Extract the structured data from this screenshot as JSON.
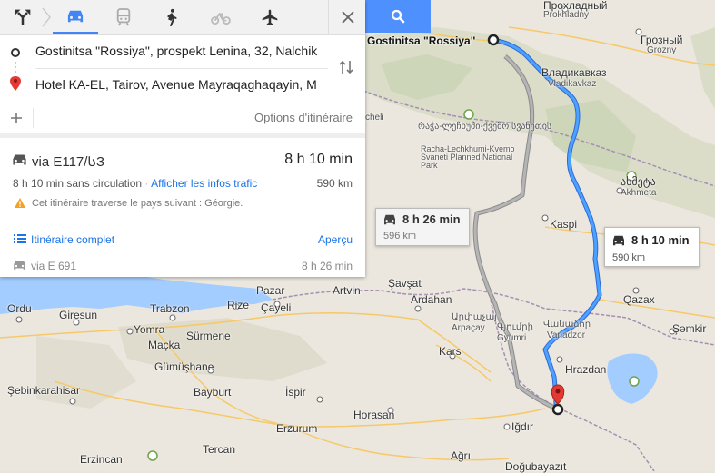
{
  "modes": [
    {
      "icon": "best-route-icon"
    },
    {
      "icon": "car-icon",
      "active": true
    },
    {
      "icon": "transit-icon"
    },
    {
      "icon": "walking-icon"
    },
    {
      "icon": "bicycle-icon"
    },
    {
      "icon": "flight-icon"
    }
  ],
  "waypoints": {
    "origin": "Gostinitsa \"Rossiya\", prospekt Lenina, 32, Nalchik",
    "destination": "Hotel KA-EL, Tairov, Avenue Mayraqaghaqayin, M",
    "options_label": "Options d'itinéraire"
  },
  "routes": {
    "primary": {
      "via": "via E117/ᲡЗ",
      "duration": "8 h 10 min",
      "no_traffic": "8 h 10 min sans circulation",
      "traffic_link": "Afficher les infos trafic",
      "distance": "590 km",
      "warning": "Cet itinéraire traverse le pays suivant : Géorgie.",
      "full_route_link": "Itinéraire complet",
      "preview_link": "Aperçu"
    },
    "alternative": {
      "via": "via E 691",
      "duration": "8 h 26 min"
    }
  },
  "map": {
    "origin_label": "Gostinitsa \"Rossiya\"",
    "callout_primary": {
      "duration": "8 h 10 min",
      "distance": "590 km"
    },
    "callout_alt": {
      "duration": "8 h 26 min",
      "distance": "596 km"
    },
    "places": {
      "prokhladny_ru": "Прохладный",
      "prokhladny": "Prokhladny",
      "grozny_ru": "Грозный",
      "grozny": "Grozny",
      "vladikavkaz_ru": "Владикавказ",
      "vladikavkaz": "Vladikavkaz",
      "cheli": "cheli",
      "racha_ka": "რაჭა-ლეჩხუმი-ქვემო სვანეთის",
      "racha": "Racha-Lechkhumi-Kvemo Svaneti Planned National Park",
      "akhmeta_ka": "ახმეტა",
      "akhmeta": "Akhmeta",
      "kaspi": "Kaspi",
      "sarpi": "Şavşat",
      "ardahan": "Ardahan",
      "artvin": "Artvin",
      "arpacay_hy": "Արփաչայ",
      "arpacay": "Arpaçay",
      "vanadzor_hy": "Վանաձոր",
      "vanadzor": "Vanadzor",
      "qazax": "Qazax",
      "semkir": "Şəmkir",
      "gyumri_hy": "Գյումրի",
      "gyumri": "Gyumri",
      "hrazdan": "Hrazdan",
      "kars": "Kars",
      "igdir": "Iğdır",
      "pazar": "Pazar",
      "rize": "Rize",
      "cayeli": "Çayeli",
      "ordu": "Ordu",
      "giresun": "Giresun",
      "trabzon": "Trabzon",
      "yomra": "Yomra",
      "macka": "Maçka",
      "surmene": "Sürmene",
      "sebinkarahisar": "Şebinkarahisar",
      "gumushane": "Gümüşhane",
      "bayburt": "Bayburt",
      "ispir": "İspir",
      "tercan": "Tercan",
      "erzurum": "Erzurum",
      "horasan": "Horasan",
      "agri": "Ağrı",
      "dogubayazit": "Doğubayazıt",
      "erzincan": "Erzincan"
    }
  }
}
